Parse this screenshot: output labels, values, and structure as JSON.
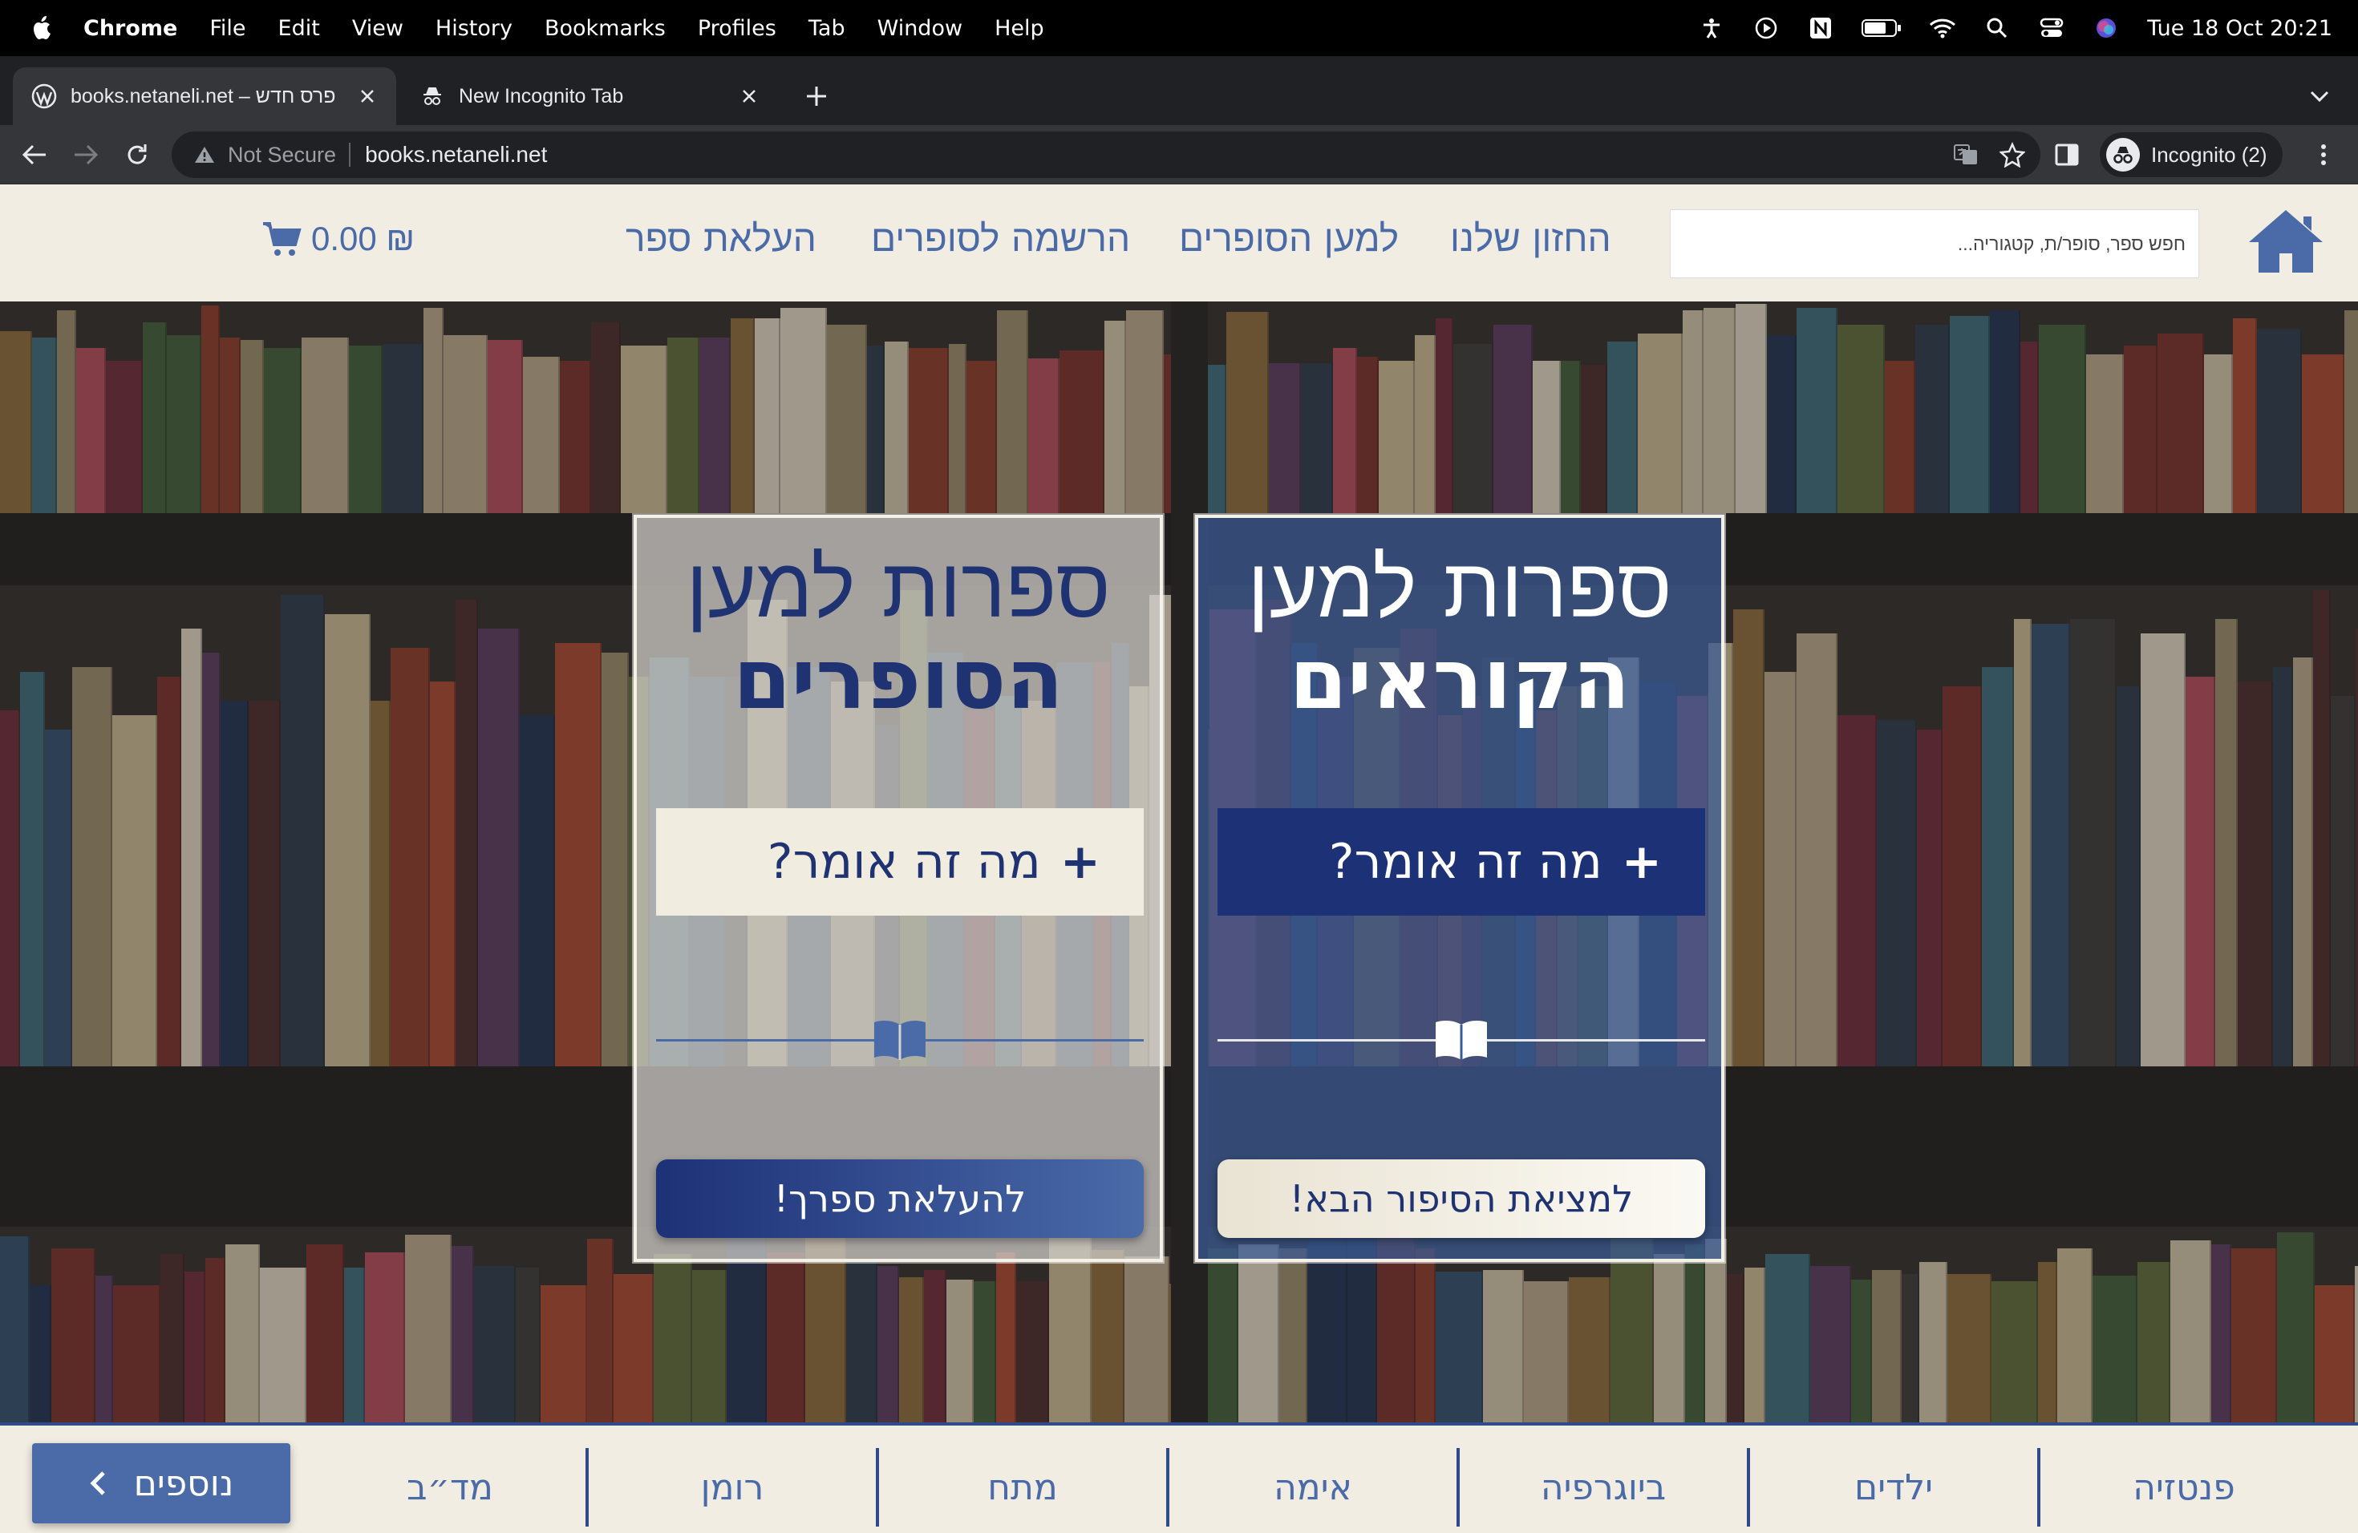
{
  "menubar": {
    "app": "Chrome",
    "items": [
      "File",
      "Edit",
      "View",
      "History",
      "Bookmarks",
      "Profiles",
      "Tab",
      "Window",
      "Help"
    ],
    "clock": "Tue 18 Oct  20:21"
  },
  "tabs": [
    {
      "title": "books.netaneli.net – פרס חדש",
      "active": true
    },
    {
      "title": "New Incognito Tab",
      "active": false
    }
  ],
  "toolbar": {
    "not_secure": "Not Secure",
    "url": "books.netaneli.net",
    "profile": "Incognito (2)"
  },
  "header": {
    "search_placeholder": "חפש ספר, סופר/ת, קטגוריה...",
    "nav": [
      "החזון שלנו",
      "למען הסופרים",
      "הרשמה לסופרים",
      "העלאת ספר"
    ],
    "cart_total": "0.00 ₪"
  },
  "panels": {
    "readers": {
      "title_light": "ספרות למען",
      "title_bold": "הקוראים",
      "expand_label": "מה זה אומר?",
      "plus": "+",
      "cta": "למציאת הסיפור הבא!"
    },
    "writers": {
      "title_light": "ספרות למען",
      "title_bold": "הסופרים",
      "expand_label": "מה זה אומר?",
      "plus": "+",
      "cta": "להעלאת ספרך!"
    }
  },
  "categories": [
    "פנטזיה",
    "ילדים",
    "ביוגרפיה",
    "אימה",
    "מתח",
    "רומן",
    "מד״ב"
  ],
  "more_button": "נוספים",
  "colors": {
    "brand_blue": "#4a6aa8",
    "dark_blue": "#1d3177",
    "cream": "#f1ede2"
  }
}
